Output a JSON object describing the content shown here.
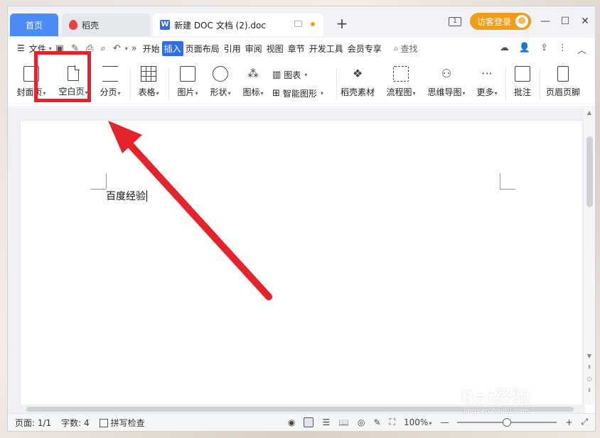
{
  "tabs": {
    "home": "首页",
    "docer": "稻壳",
    "document": "新建 DOC 文档 (2).doc",
    "new_tab": "+"
  },
  "window": {
    "book_label": "1",
    "visitor_login": "访客登录",
    "minimize": "—",
    "maximize": "☐",
    "close": "✕"
  },
  "menu": {
    "file": "文件",
    "items": [
      "开始",
      "插入",
      "页面布局",
      "引用",
      "审阅",
      "视图",
      "章节",
      "开发工具",
      "会员专享"
    ],
    "active": "插入",
    "search": "查找",
    "more": "»"
  },
  "ribbon": {
    "cover": "封面页",
    "blank_page": "空白页",
    "page_break": "分页",
    "table": "表格",
    "picture": "图片",
    "shape": "形状",
    "icon": "图标",
    "chart": "图表",
    "smart_art": "智能图形",
    "docer_material": "稻壳素材",
    "flowchart": "流程图",
    "mindmap": "思维导图",
    "more": "更多",
    "comment": "批注",
    "header_footer": "页眉页脚"
  },
  "document": {
    "text": "百度经验"
  },
  "status": {
    "page": "页面: 1/1",
    "words": "字数: 4",
    "spellcheck": "拼写检查",
    "zoom": "100%",
    "zoom_minus": "—",
    "zoom_plus": "+"
  },
  "watermark": {
    "brand": "Bai经验",
    "url": "jingyan.baidu.com"
  },
  "colors": {
    "accent": "#2f6fe3",
    "home_tab": "#4a8bf5",
    "visitor": "#f29d1a",
    "highlight": "#e5232b"
  }
}
